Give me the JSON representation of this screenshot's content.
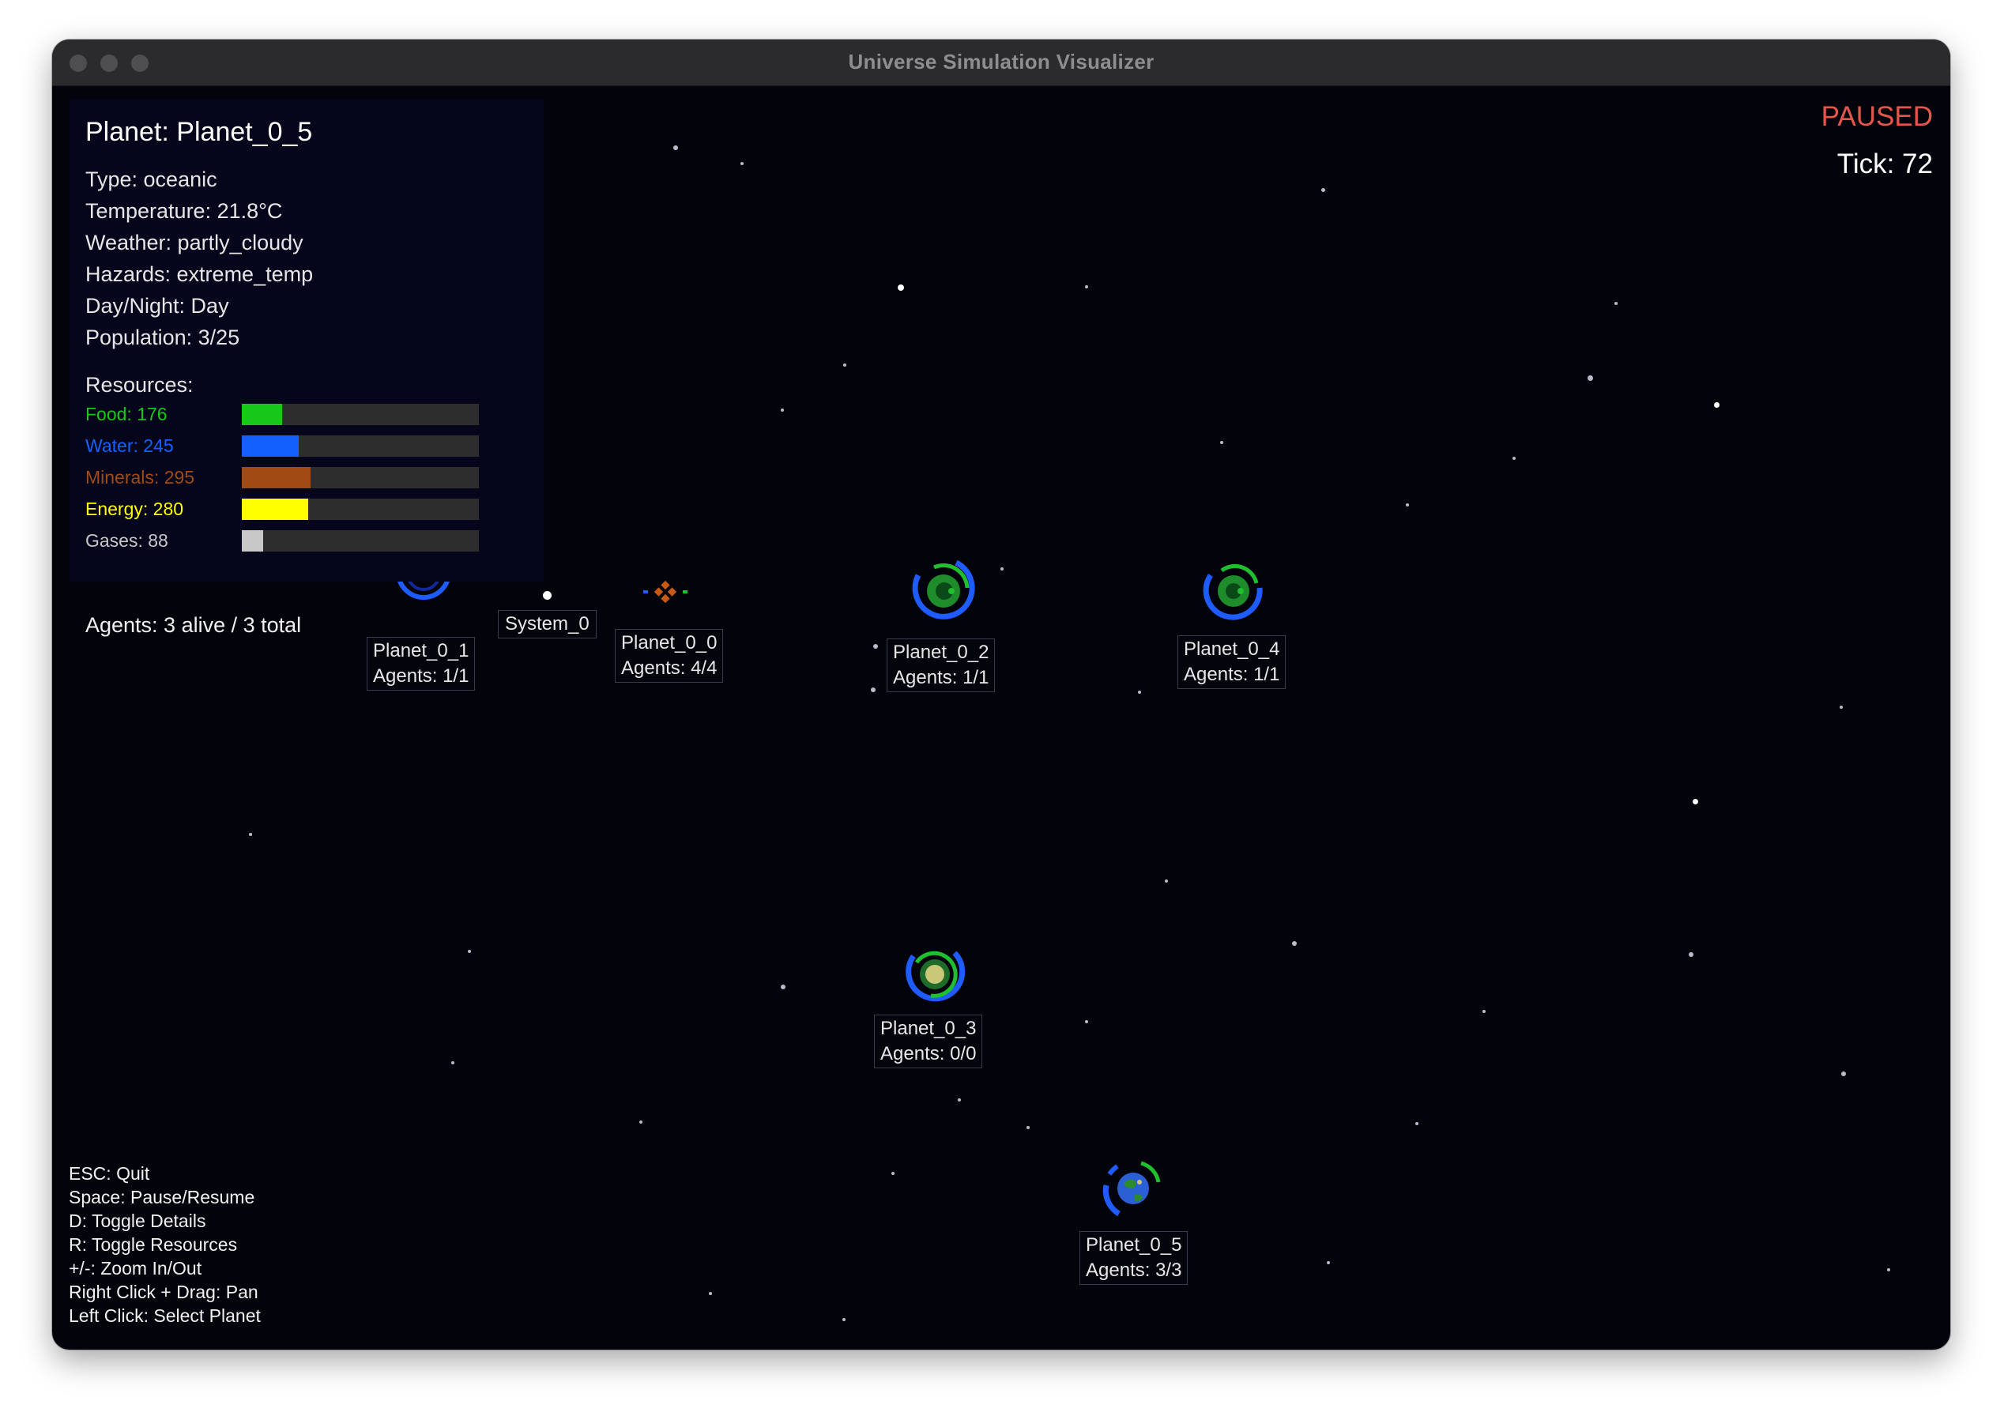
{
  "window": {
    "title": "Universe Simulation Visualizer"
  },
  "status": {
    "state": "PAUSED",
    "tick_text": "Tick: 72"
  },
  "details": {
    "title": "Planet: Planet_0_5",
    "type": "Type: oceanic",
    "temperature": "Temperature: 21.8°C",
    "weather": "Weather: partly_cloudy",
    "hazards": "Hazards: extreme_temp",
    "day_night": "Day/Night: Day",
    "population": "Population: 3/25",
    "resources_heading": "Resources:",
    "resources": [
      {
        "label": "Food: 176",
        "fraction": 0.17,
        "color": "#18c818"
      },
      {
        "label": "Water: 245",
        "fraction": 0.24,
        "color": "#1461ff"
      },
      {
        "label": "Minerals: 295",
        "fraction": 0.29,
        "color": "#a04a14"
      },
      {
        "label": "Energy: 280",
        "fraction": 0.28,
        "color": "#ffff00"
      },
      {
        "label": "Gases: 88",
        "fraction": 0.09,
        "color": "#c8c8c8"
      }
    ],
    "agents": "Agents: 3 alive / 3 total"
  },
  "system": {
    "label": "System_0"
  },
  "planets": [
    {
      "name": "Planet_0_1",
      "agents": "Agents: 1/1"
    },
    {
      "name": "Planet_0_0",
      "agents": "Agents: 4/4"
    },
    {
      "name": "Planet_0_2",
      "agents": "Agents: 1/1"
    },
    {
      "name": "Planet_0_4",
      "agents": "Agents: 1/1"
    },
    {
      "name": "Planet_0_3",
      "agents": "Agents: 0/0"
    },
    {
      "name": "Planet_0_5",
      "agents": "Agents: 3/3"
    }
  ],
  "controls": [
    "ESC: Quit",
    "Space: Pause/Resume",
    "D: Toggle Details",
    "R: Toggle Resources",
    "+/-: Zoom In/Out",
    "Right Click + Drag: Pan",
    "Left Click: Select Planet"
  ],
  "colors": {
    "paused": "#e4574a",
    "background": "#03030c",
    "orbit_blue": "#1f5cff",
    "orbit_green": "#1fbf2f"
  }
}
